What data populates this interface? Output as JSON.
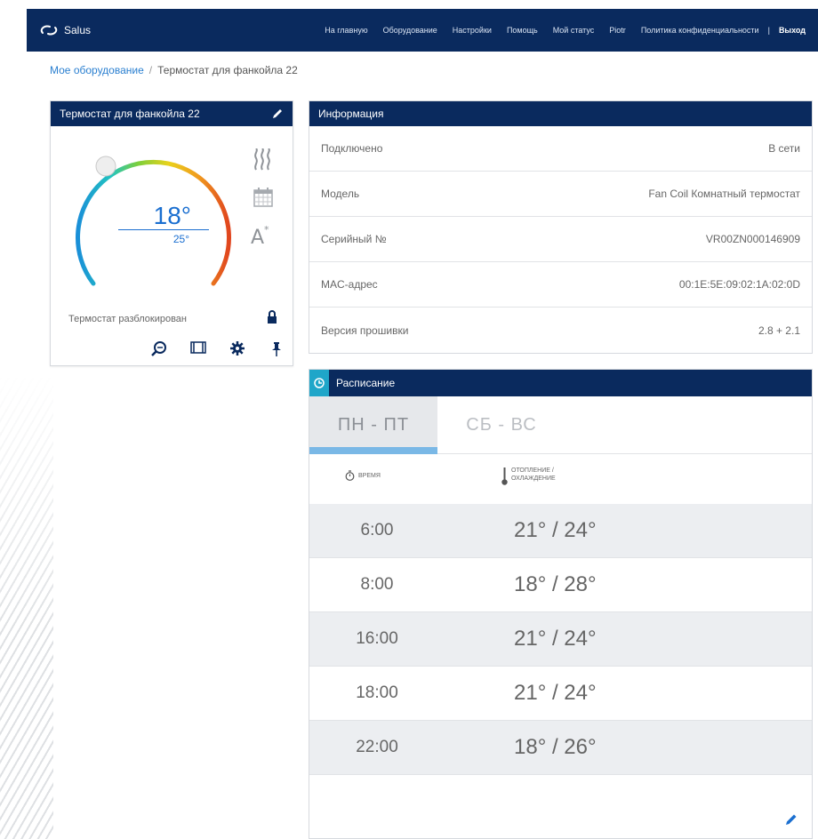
{
  "nav": {
    "brand": "Salus",
    "links": [
      "На главную",
      "Оборудование",
      "Настройки",
      "Помощь",
      "Мой статус",
      "Piotr",
      "Политика конфиденциальности"
    ],
    "separator": "|",
    "logout": "Выход"
  },
  "breadcrumb": {
    "root": "Мое оборудование",
    "separator": "/",
    "current": "Термостат для фанкойла 22"
  },
  "thermostat": {
    "title": "Термостат для фанкойла 22",
    "temperature": "18°",
    "setpoint": "25°",
    "lock_status": "Термостат разблокирован",
    "colors": {
      "header": "#0a2a5e",
      "temp": "#1b6fd0"
    }
  },
  "info": {
    "title": "Информация",
    "rows": [
      {
        "label": "Подключено",
        "value": "В сети"
      },
      {
        "label": "Модель",
        "value": "Fan Coil Комнатный термостат"
      },
      {
        "label": "Серийный №",
        "value": "VR00ZN000146909"
      },
      {
        "label": "MAC-адрес",
        "value": "00:1E:5E:09:02:1A:02:0D"
      },
      {
        "label": "Версия прошивки",
        "value": "2.8 + 2.1"
      }
    ]
  },
  "schedule": {
    "title": "Расписание",
    "tabs": [
      "ПН - ПТ",
      "СБ - ВС"
    ],
    "active_tab": "ПН - ПТ",
    "col_time": "ВРЕМЯ",
    "col_temp_1": "ОТОПЛЕНИЕ /",
    "col_temp_2": "ОХЛАЖДЕНИЕ",
    "rows": [
      {
        "time": "6:00",
        "value": "21° / 24°"
      },
      {
        "time": "8:00",
        "value": "18° / 28°"
      },
      {
        "time": "16:00",
        "value": "21° / 24°"
      },
      {
        "time": "18:00",
        "value": "21° / 24°"
      },
      {
        "time": "22:00",
        "value": "18° / 26°"
      }
    ]
  }
}
